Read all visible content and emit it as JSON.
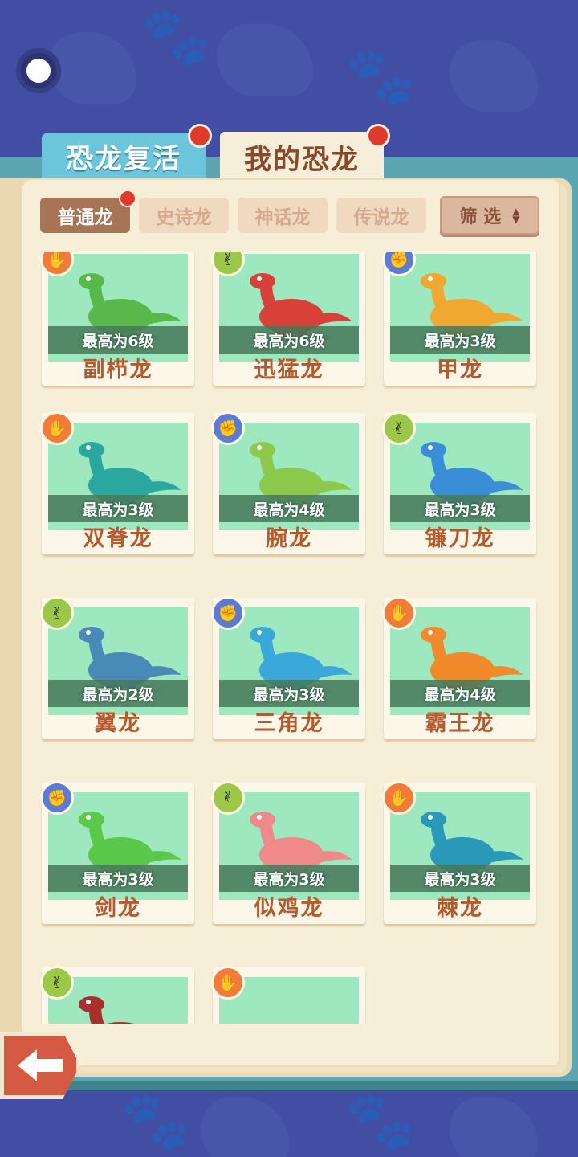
{
  "tabs": {
    "revive_label": "恐龙复活",
    "mine_label": "我的恐龙"
  },
  "categories": [
    {
      "label": "普通龙",
      "active": true
    },
    {
      "label": "史诗龙",
      "active": false
    },
    {
      "label": "神话龙",
      "active": false
    },
    {
      "label": "传说龙",
      "active": false
    }
  ],
  "filter": {
    "label": "筛 选"
  },
  "cards": [
    {
      "name": "副栉龙",
      "level": "最高为6级",
      "badge": "orange",
      "badge_icon": "palm-icon",
      "color": "#58b84a"
    },
    {
      "name": "迅猛龙",
      "level": "最高为6级",
      "badge": "green",
      "badge_icon": "scissors-icon",
      "color": "#d8403a"
    },
    {
      "name": "甲龙",
      "level": "最高为3级",
      "badge": "blue",
      "badge_icon": "fist-icon",
      "color": "#f0a830"
    },
    {
      "name": "双脊龙",
      "level": "最高为3级",
      "badge": "orange",
      "badge_icon": "palm-icon",
      "color": "#2aa8a0"
    },
    {
      "name": "腕龙",
      "level": "最高为4级",
      "badge": "blue",
      "badge_icon": "fist-icon",
      "color": "#8cc84a"
    },
    {
      "name": "镰刀龙",
      "level": "最高为3级",
      "badge": "green",
      "badge_icon": "scissors-icon",
      "color": "#3a8ed8"
    },
    {
      "name": "翼龙",
      "level": "最高为2级",
      "badge": "green",
      "badge_icon": "scissors-icon",
      "color": "#4a8ab8"
    },
    {
      "name": "三角龙",
      "level": "最高为3级",
      "badge": "blue",
      "badge_icon": "fist-icon",
      "color": "#3aa8d8"
    },
    {
      "name": "霸王龙",
      "level": "最高为4级",
      "badge": "orange",
      "badge_icon": "palm-icon",
      "color": "#f08a2a"
    },
    {
      "name": "剑龙",
      "level": "最高为3级",
      "badge": "blue",
      "badge_icon": "fist-icon",
      "color": "#5ac84a"
    },
    {
      "name": "似鸡龙",
      "level": "最高为3级",
      "badge": "green",
      "badge_icon": "scissors-icon",
      "color": "#f08a8a"
    },
    {
      "name": "棘龙",
      "level": "最高为3级",
      "badge": "orange",
      "badge_icon": "palm-icon",
      "color": "#2a98b8"
    },
    {
      "name": "",
      "level": "",
      "badge": "green",
      "badge_icon": "scissors-icon",
      "color": "#a8302a"
    },
    {
      "name": "",
      "level": "",
      "badge": "orange",
      "badge_icon": "palm-icon",
      "color": "#9de8be"
    }
  ]
}
